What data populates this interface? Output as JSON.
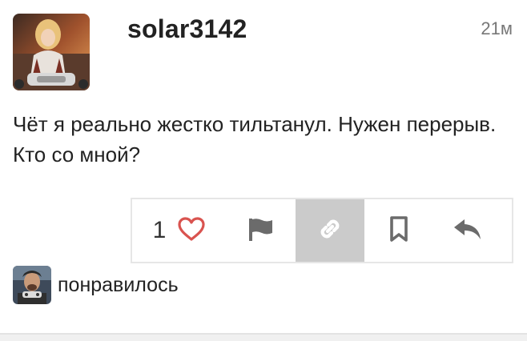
{
  "post": {
    "username": "solar3142",
    "timestamp": "21м",
    "text": "Чёт я реально жестко тильтанул. Нужен перерыв. Кто со мной?"
  },
  "actions": {
    "like_count": "1",
    "icons": [
      "heart-icon",
      "flag-icon",
      "link-icon",
      "bookmark-icon",
      "reply-icon"
    ]
  },
  "liked_by": {
    "label": "понравилось"
  },
  "colors": {
    "heart": "#d9534f",
    "icon_gray": "#6b6b6b",
    "selected_bg": "#cbcbcb"
  }
}
